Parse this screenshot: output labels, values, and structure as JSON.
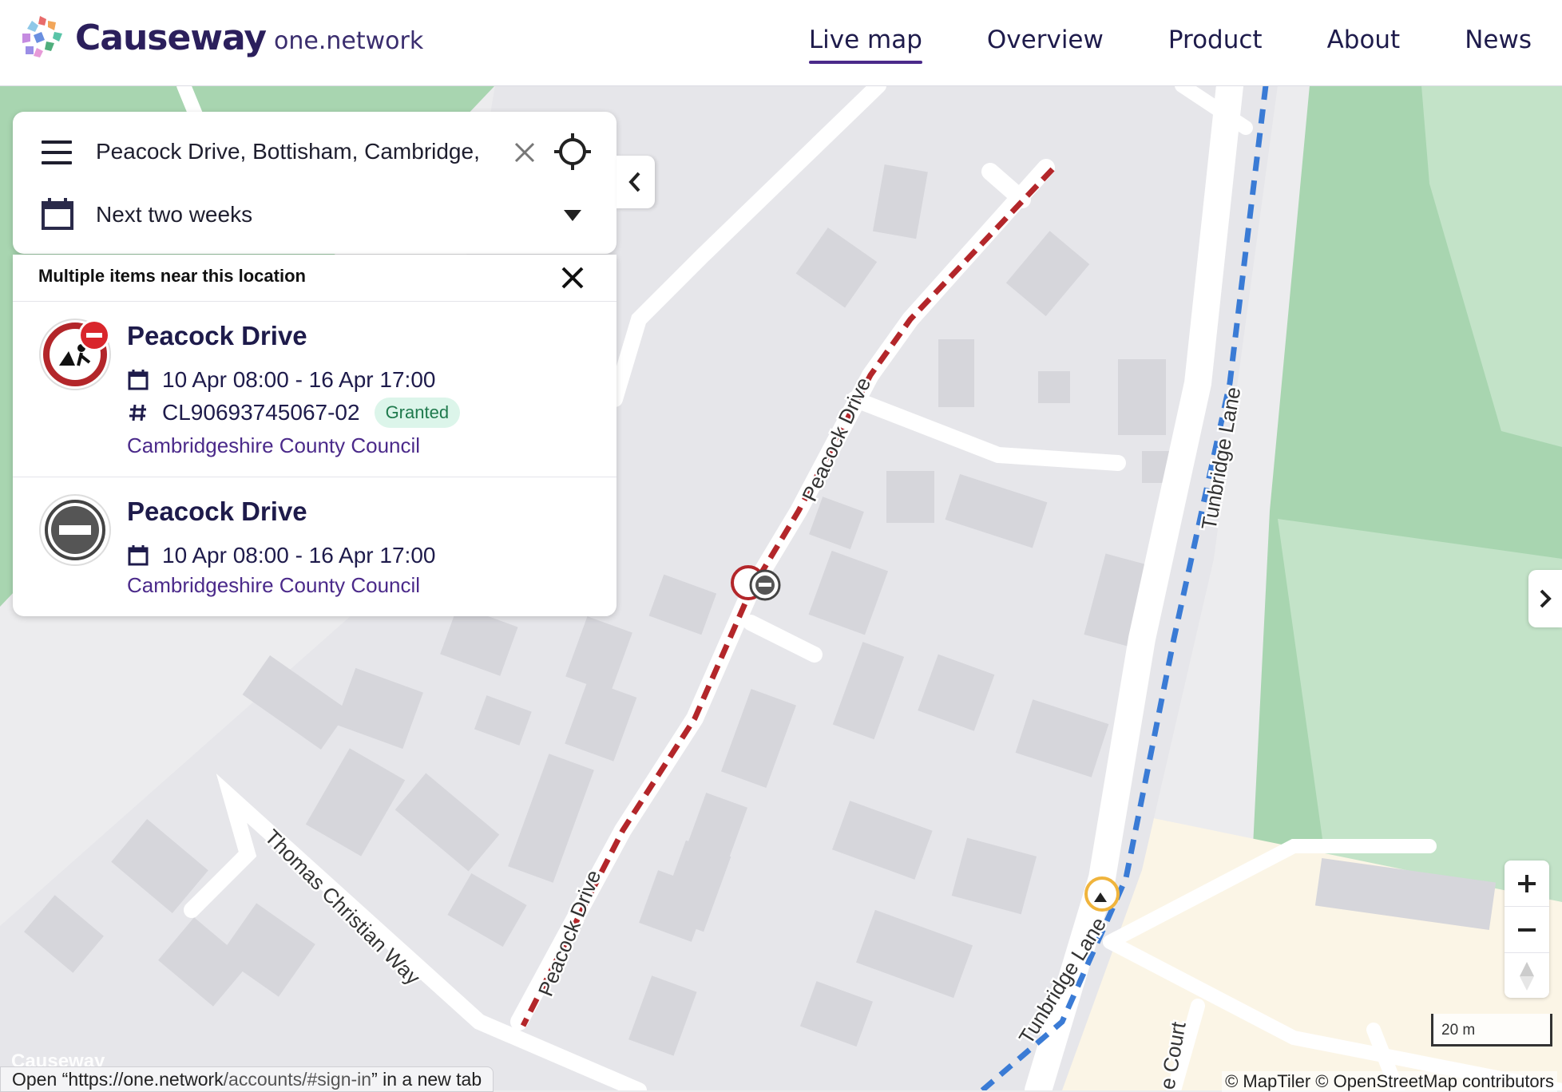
{
  "brand": {
    "name": "Causeway",
    "sub": "one.network"
  },
  "nav": [
    {
      "label": "Live map",
      "active": true
    },
    {
      "label": "Overview"
    },
    {
      "label": "Product"
    },
    {
      "label": "About"
    },
    {
      "label": "News"
    }
  ],
  "search": {
    "value": "Peacock Drive, Bottisham, Cambridge,"
  },
  "date_filter": {
    "value": "Next two weeks"
  },
  "results": {
    "title": "Multiple items near this location",
    "items": [
      {
        "title": "Peacock Drive",
        "dates": "10 Apr 08:00 - 16 Apr 17:00",
        "ref": "CL90693745067-02",
        "status": "Granted",
        "authority": "Cambridgeshire County Council",
        "icon": "roadworks-closure-icon"
      },
      {
        "title": "Peacock Drive",
        "dates": "10 Apr 08:00 - 16 Apr 17:00",
        "authority": "Cambridgeshire County Council",
        "icon": "no-entry-icon"
      }
    ]
  },
  "map": {
    "roads": [
      "Peacock Drive",
      "Peacock Drive",
      "Tunbridge Lane",
      "Tunbridge Lane",
      "Thomas Christian Way",
      "e Court"
    ],
    "scale_label": "20 m",
    "attribution": "© MapTiler © OpenStreetMap contributors",
    "watermark": "Causeway",
    "colors": {
      "closure": "#b3262a",
      "diversion": "#3a7bd5",
      "park": "#a8d5b0",
      "residential": "#fbf5e6"
    }
  },
  "status_bar": {
    "prefix": "Open “",
    "host": "https://one.network",
    "path": "/accounts/#sign-in",
    "suffix": "” in a new tab"
  }
}
